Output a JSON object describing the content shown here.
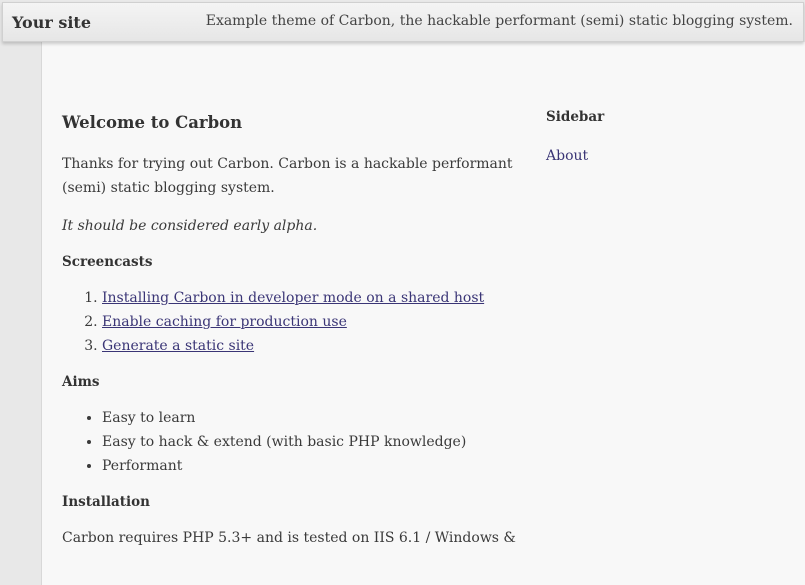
{
  "header": {
    "site_title": "Your site",
    "tagline": "Example theme of Carbon, the hackable performant (semi) static blogging system."
  },
  "post": {
    "title": "Welcome to Carbon",
    "intro": "Thanks for trying out Carbon. Carbon is a hackable performant (semi) static blogging system.",
    "alpha_note": "It should be considered early alpha.",
    "screencasts": {
      "heading": "Screencasts",
      "items": [
        "Installing Carbon in developer mode on a shared host",
        "Enable caching for production use",
        "Generate a static site"
      ]
    },
    "aims": {
      "heading": "Aims",
      "items": [
        "Easy to learn",
        "Easy to hack & extend (with basic PHP knowledge)",
        "Performant"
      ]
    },
    "installation": {
      "heading": "Installation",
      "text": "Carbon requires PHP 5.3+ and is tested on IIS 6.1 / Windows &"
    }
  },
  "sidebar": {
    "heading": "Sidebar",
    "links": [
      "About"
    ]
  },
  "colors": {
    "link": "#3a3576",
    "text": "#3a3a3a",
    "page_bg": "#f8f8f8"
  }
}
